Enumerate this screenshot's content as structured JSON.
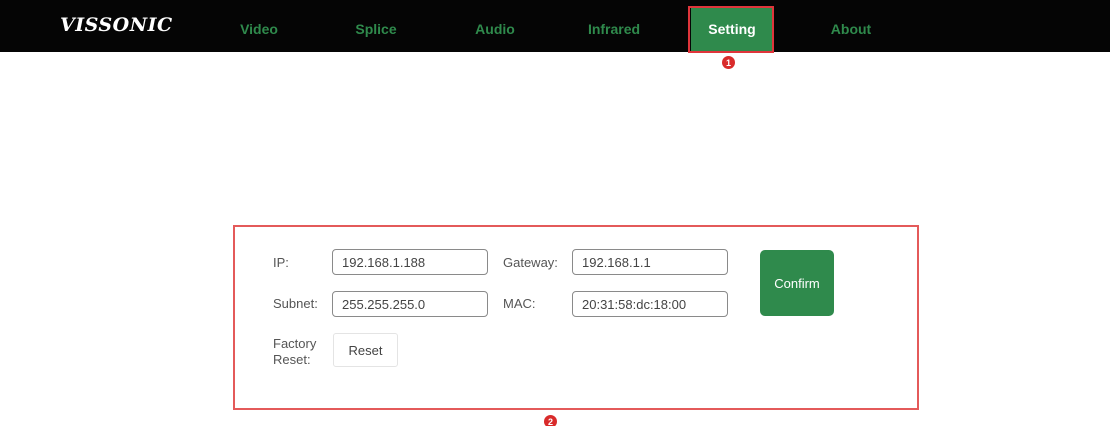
{
  "brand": {
    "logo": "VISSONIC"
  },
  "nav": {
    "items": [
      {
        "label": "Video"
      },
      {
        "label": "Splice"
      },
      {
        "label": "Audio"
      },
      {
        "label": "Infrared"
      },
      {
        "label": "Setting",
        "active": true
      },
      {
        "label": "About"
      }
    ]
  },
  "annotations": {
    "marker1": "1",
    "marker2": "2"
  },
  "settings": {
    "ip_label": "IP:",
    "ip_value": "192.168.1.188",
    "gateway_label": "Gateway:",
    "gateway_value": "192.168.1.1",
    "subnet_label": "Subnet:",
    "subnet_value": "255.255.255.0",
    "mac_label": "MAC:",
    "mac_value": "20:31:58:dc:18:00",
    "factory_reset_label_line1": "Factory",
    "factory_reset_label_line2": "Reset:",
    "reset_button": "Reset",
    "confirm_button": "Confirm"
  },
  "colors": {
    "topbar_bg": "#050505",
    "nav_text": "#2f8a4c",
    "accent_green": "#2f8a4c",
    "annotation_red": "#e0353b"
  }
}
